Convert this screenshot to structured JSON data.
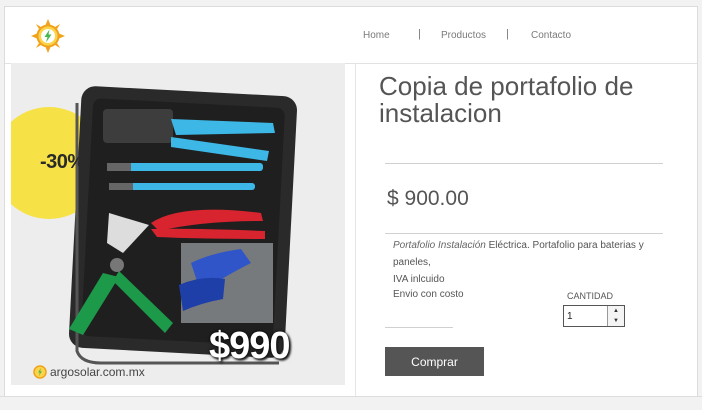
{
  "nav": {
    "home": "Home",
    "products": "Productos",
    "contact": "Contacto",
    "separator": "|"
  },
  "image": {
    "discount_badge": "-30%",
    "price_overlay": "$990",
    "watermark": "argosolar.com.mx"
  },
  "product": {
    "title": "Copia de portafolio de instalacion",
    "price": "$ 900.00",
    "desc_italic": "Portafolio Instalación",
    "desc_rest": " Eléctrica. Portafolio para baterias y paneles,",
    "desc_line2": "IVA inlcuido",
    "shipping": "Envio con costo",
    "qty_label": "CANTIDAD",
    "qty_value": "1",
    "buy_label": "Comprar"
  },
  "colors": {
    "badge": "#f6e146",
    "button": "#555555",
    "logo_orange": "#f1a21b",
    "logo_green": "#46b84a"
  },
  "icons": {
    "logo": "sun-lightning-logo-icon",
    "spin_up": "spin-up-icon",
    "spin_down": "spin-down-icon"
  }
}
